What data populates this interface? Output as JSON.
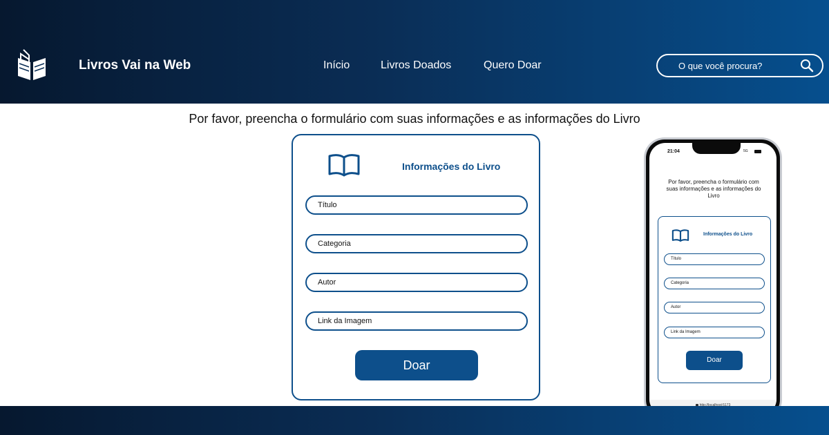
{
  "header": {
    "brand": "Livros Vai na Web",
    "logo_icon": "open-book-logo-icon",
    "nav": [
      {
        "label": "Início"
      },
      {
        "label": "Livros Doados"
      },
      {
        "label": "Quero Doar"
      }
    ],
    "search": {
      "placeholder": "O que você procura?",
      "value": "",
      "icon": "search-icon"
    }
  },
  "main": {
    "instructions": "Por favor, preencha o formulário com suas informações e as informações do Livro",
    "form": {
      "title": "Informações do Livro",
      "icon": "book-icon",
      "fields": [
        {
          "placeholder": "Título"
        },
        {
          "placeholder": "Categoria"
        },
        {
          "placeholder": "Autor"
        },
        {
          "placeholder": "Link da Imagem"
        }
      ],
      "submit_label": "Doar"
    }
  },
  "phone_mockup": {
    "time": "21:04",
    "network": "5G",
    "instructions": "Por favor, preencha o formulário com suas informações e as informações do Livro",
    "form_title": "Informações do Livro",
    "fields": [
      "Título",
      "Categoria",
      "Autor",
      "Link da Imagem"
    ],
    "submit_label": "Doar",
    "url": "http://localhost:5173"
  },
  "colors": {
    "header_dark": "#06182f",
    "header_light": "#064f8e",
    "accent": "#0d4f8b",
    "background": "#ffffff"
  }
}
